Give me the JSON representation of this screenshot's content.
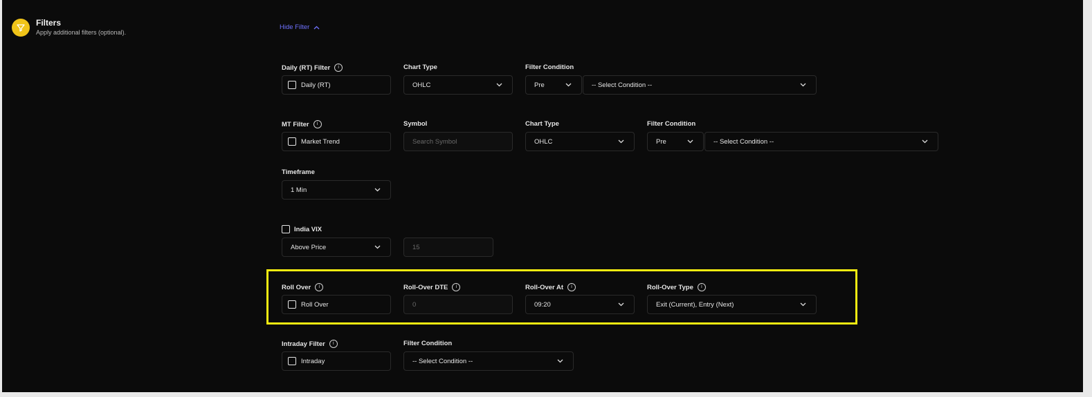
{
  "header": {
    "title": "Filters",
    "subtitle": "Apply additional filters (optional).",
    "hide_filter": "Hide Filter"
  },
  "daily": {
    "label": "Daily (RT) Filter",
    "checkbox_label": "Daily (RT)",
    "chart_type_label": "Chart Type",
    "chart_type_value": "OHLC",
    "filter_condition_label": "Filter Condition",
    "pre_value": "Pre",
    "condition_value": "-- Select Condition --"
  },
  "mt": {
    "label": "MT Filter",
    "checkbox_label": "Market Trend",
    "symbol_label": "Symbol",
    "symbol_placeholder": "Search Symbol",
    "chart_type_label": "Chart Type",
    "chart_type_value": "OHLC",
    "filter_condition_label": "Filter Condition",
    "pre_value": "Pre",
    "condition_value": "-- Select Condition --",
    "timeframe_label": "Timeframe",
    "timeframe_value": "1 Min"
  },
  "vix": {
    "checkbox_label": "India VIX",
    "type_value": "Above Price",
    "price_placeholder": "15"
  },
  "rollover": {
    "label": "Roll Over",
    "checkbox_label": "Roll Over",
    "dte_label": "Roll-Over DTE",
    "dte_placeholder": "0",
    "at_label": "Roll-Over At",
    "at_value": "09:20",
    "type_label": "Roll-Over Type",
    "type_value": "Exit (Current), Entry (Next)"
  },
  "intraday": {
    "label": "Intraday Filter",
    "checkbox_label": "Intraday",
    "filter_condition_label": "Filter Condition",
    "condition_value": "-- Select Condition --"
  },
  "colors": {
    "background": "#0b0b0b",
    "accent_link": "#6f72ff",
    "icon_yellow": "#f0c419",
    "highlight_yellow": "#f5eb11"
  },
  "icons": {
    "header": "filter-icon",
    "info": "info-icon",
    "dropdown": "chevron-down-icon",
    "collapse": "chevron-up-icon"
  }
}
